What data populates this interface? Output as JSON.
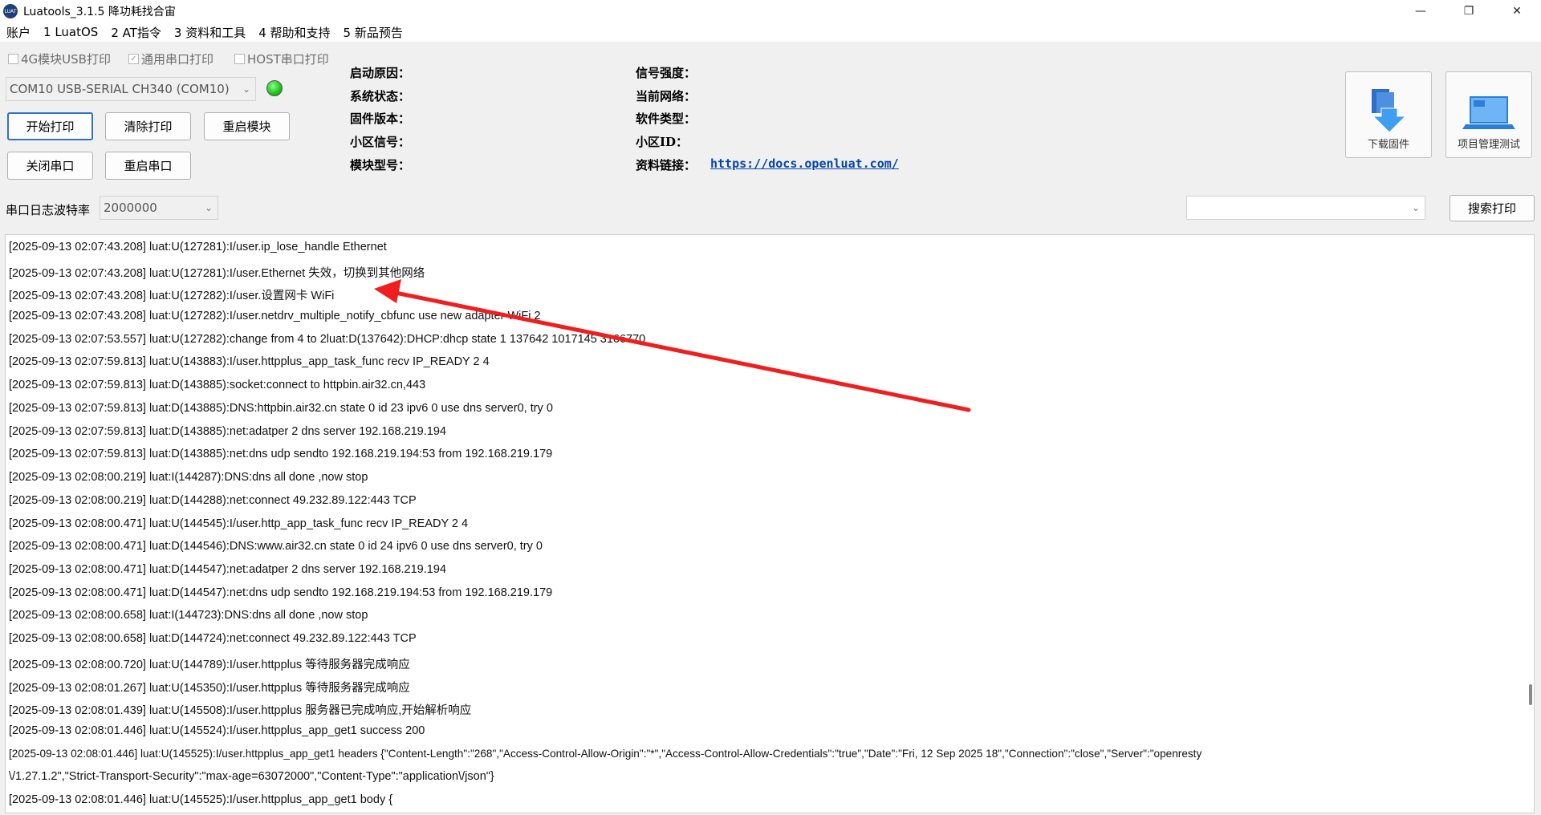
{
  "window": {
    "title": "Luatools_3.1.5 降功耗找合宙",
    "icon": "luatools-logo-icon",
    "controls": [
      "minimize-icon",
      "maximize-icon",
      "close-icon"
    ]
  },
  "menu": [
    "账户",
    "1 LuatOS",
    "2 AT指令",
    "3 资料和工具",
    "4 帮助和支持",
    "5 新品预告"
  ],
  "print_options": [
    {
      "label": "4G模块USB打印",
      "checked": false
    },
    {
      "label": "通用串口打印",
      "checked": true
    },
    {
      "label": "HOST串口打印",
      "checked": false
    }
  ],
  "port_select": {
    "value": "COM10 USB-SERIAL CH340 (COM10)"
  },
  "status_led_color": "#17c117",
  "buttons": {
    "start_print": "开始打印",
    "clear_print": "清除打印",
    "restart_module": "重启模块",
    "close_port": "关闭串口",
    "restart_port": "重启串口",
    "search_print": "搜索打印",
    "download_firmware": "下载固件",
    "project_test": "项目管理测试"
  },
  "info": {
    "boot_reason": "启动原因：",
    "system_state": "系统状态：",
    "firmware_version": "固件版本：",
    "cell_signal": "小区信号：",
    "module_model": "模块型号：",
    "signal_strength": "信号强度：",
    "current_network": "当前网络：",
    "software_type": "软件类型：",
    "cell_id": "小区ID：",
    "docs_link_label": "资料链接：",
    "docs_link": "https://docs.openluat.com/"
  },
  "baud": {
    "label": "串口日志波特率",
    "value": "2000000"
  },
  "search_combo": {
    "value": ""
  },
  "annotation_arrow_color": "#f01e1e",
  "log_lines": [
    "[2025-09-13 02:07:43.208] luat:U(127281):I/user.ip_lose_handle Ethernet",
    "[2025-09-13 02:07:43.208] luat:U(127281):I/user.Ethernet 失效，切换到其他网络",
    "[2025-09-13 02:07:43.208] luat:U(127282):I/user.设置网卡 WiFi",
    "[2025-09-13 02:07:43.208] luat:U(127282):I/user.netdrv_multiple_notify_cbfunc use new adapter WiFi 2",
    "[2025-09-13 02:07:53.557] luat:U(127282):change from 4 to 2luat:D(137642):DHCP:dhcp state 1 137642 1017145 3166770",
    "[2025-09-13 02:07:59.813] luat:U(143883):I/user.httpplus_app_task_func recv IP_READY 2 4",
    "[2025-09-13 02:07:59.813] luat:D(143885):socket:connect to httpbin.air32.cn,443",
    "[2025-09-13 02:07:59.813] luat:D(143885):DNS:httpbin.air32.cn state 0 id 23 ipv6 0 use dns server0, try 0",
    "[2025-09-13 02:07:59.813] luat:D(143885):net:adatper 2 dns server 192.168.219.194",
    "[2025-09-13 02:07:59.813] luat:D(143885):net:dns udp sendto 192.168.219.194:53 from 192.168.219.179",
    "[2025-09-13 02:08:00.219] luat:I(144287):DNS:dns all done ,now stop",
    "[2025-09-13 02:08:00.219] luat:D(144288):net:connect 49.232.89.122:443 TCP",
    "[2025-09-13 02:08:00.471] luat:U(144545):I/user.http_app_task_func recv IP_READY 2 4",
    "[2025-09-13 02:08:00.471] luat:D(144546):DNS:www.air32.cn state 0 id 24 ipv6 0 use dns server0, try 0",
    "[2025-09-13 02:08:00.471] luat:D(144547):net:adatper 2 dns server 192.168.219.194",
    "[2025-09-13 02:08:00.471] luat:D(144547):net:dns udp sendto 192.168.219.194:53 from 192.168.219.179",
    "[2025-09-13 02:08:00.658] luat:I(144723):DNS:dns all done ,now stop",
    "[2025-09-13 02:08:00.658] luat:D(144724):net:connect 49.232.89.122:443 TCP",
    "[2025-09-13 02:08:00.720] luat:U(144789):I/user.httpplus 等待服务器完成响应",
    "[2025-09-13 02:08:01.267] luat:U(145350):I/user.httpplus 等待服务器完成响应",
    "[2025-09-13 02:08:01.439] luat:U(145508):I/user.httpplus 服务器已完成响应,开始解析响应",
    "[2025-09-13 02:08:01.446] luat:U(145524):I/user.httpplus_app_get1 success 200",
    "[2025-09-13 02:08:01.446] luat:U(145525):I/user.httpplus_app_get1 headers {\"Content-Length\":\"268\",\"Access-Control-Allow-Origin\":\"*\",\"Access-Control-Allow-Credentials\":\"true\",\"Date\":\"Fri, 12 Sep 2025 18\",\"Connection\":\"close\",\"Server\":\"openresty",
    "\\/1.27.1.2\",\"Strict-Transport-Security\":\"max-age=63072000\",\"Content-Type\":\"application\\/json\"}",
    "[2025-09-13 02:08:01.446] luat:U(145525):I/user.httpplus_app_get1 body {"
  ]
}
